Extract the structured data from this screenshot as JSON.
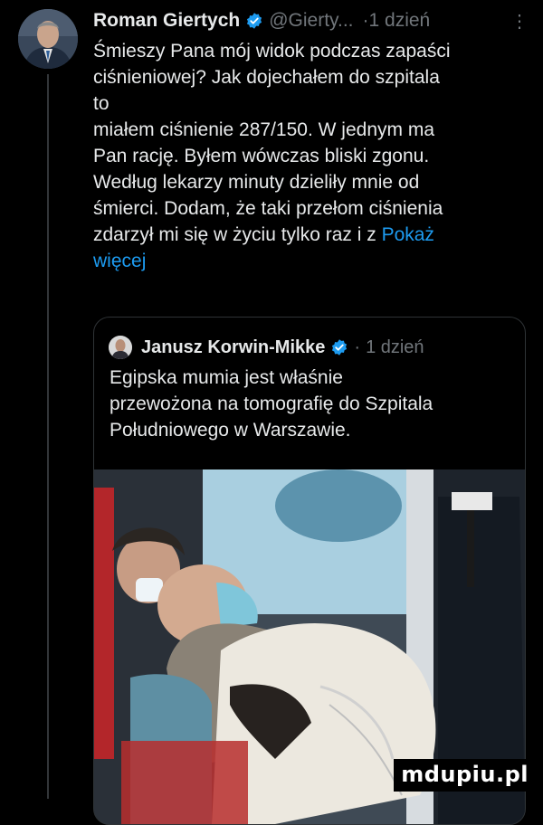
{
  "tweet": {
    "author_name": "Roman Giertych",
    "handle": "@Gierty...",
    "separator": "·",
    "time": "1 dzień",
    "menu_icon": "more-icon",
    "text": "Śmieszy Pana mój widok podczas zapaści\nciśnieniowej? Jak dojechałem do szpitala\nto\nmiałem ciśnienie 287/150. W jednym ma\nPan rację. Byłem wówczas bliski zgonu.\nWedług lekarzy minuty dzieliły mnie od\nśmierci. Dodam, że taki przełom ciśnienia\nzdarzył mi się w życiu tylko raz i z ",
    "show_more": "Pokaż\nwięcej"
  },
  "quoted": {
    "author_name": "Janusz Korwin-Mikke",
    "separator": "·",
    "time": "1 dzień",
    "text": "Egipska mumia jest właśnie\nprzewożona na tomografię do Szpitala\nPołudniowego w Warszawie."
  },
  "watermark": "mdupiu.pl",
  "colors": {
    "background": "#000000",
    "text": "#e7e9ea",
    "muted": "#71767b",
    "link": "#1d9bf0",
    "verified": "#1d9bf0"
  }
}
